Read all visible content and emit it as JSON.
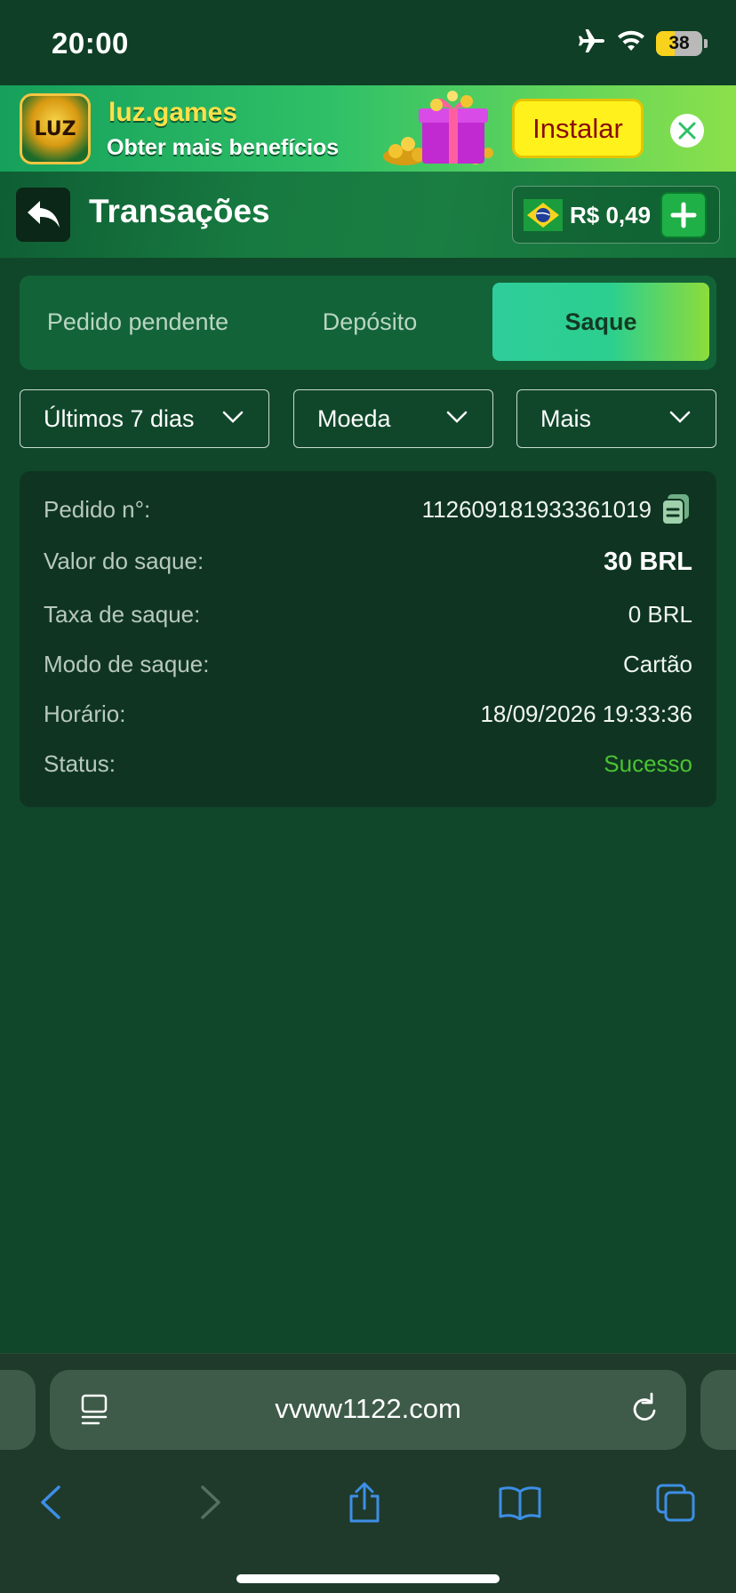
{
  "status_bar": {
    "time": "20:00",
    "battery": "38",
    "icons": [
      "airplane-icon",
      "wifi-icon",
      "battery-icon"
    ]
  },
  "promo": {
    "logo_text": "LUZ",
    "title": "luz.games",
    "subtitle": "Obter mais benefícios",
    "install_label": "Instalar"
  },
  "header": {
    "title": "Transações",
    "balance": "R$ 0,49"
  },
  "tabs": [
    {
      "label": "Pedido pendente",
      "active": false
    },
    {
      "label": "Depósito",
      "active": false
    },
    {
      "label": "Saque",
      "active": true
    }
  ],
  "filters": {
    "period": "Últimos 7 dias",
    "currency": "Moeda",
    "more": "Mais"
  },
  "transaction": {
    "order_label": "Pedido n°:",
    "order_value": "112609181933361019",
    "amount_label": "Valor do saque:",
    "amount_value": "30 BRL",
    "fee_label": "Taxa de saque:",
    "fee_value": "0 BRL",
    "mode_label": "Modo de saque:",
    "mode_value": "Cartão",
    "time_label": "Horário:",
    "time_value": "18/09/2026 19:33:36",
    "status_label": "Status:",
    "status_value": "Sucesso"
  },
  "browser": {
    "url": "vvww1122.com"
  },
  "colors": {
    "background": "#10472a",
    "accent": "#2fcd9b",
    "success": "#4bc232",
    "install": "#fff21c"
  }
}
